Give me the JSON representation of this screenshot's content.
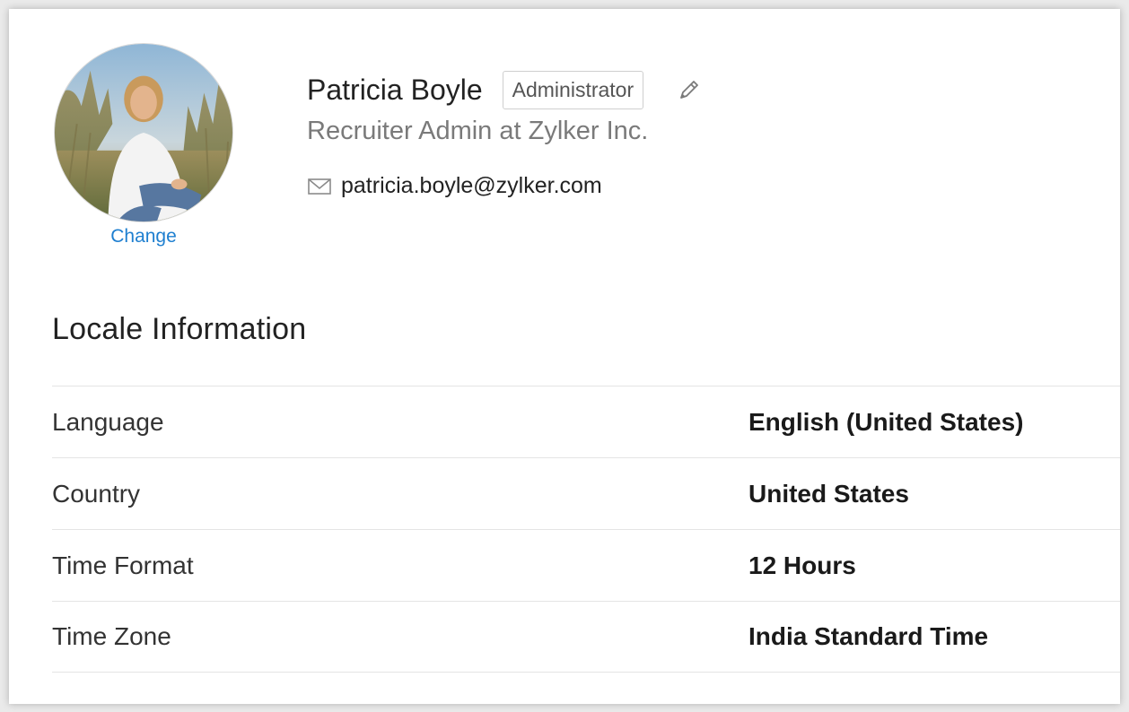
{
  "profile": {
    "name": "Patricia Boyle",
    "role_badge": "Administrator",
    "job_title": "Recruiter Admin at Zylker Inc.",
    "email": "patricia.boyle@zylker.com",
    "change_photo_label": "Change"
  },
  "locale": {
    "title": "Locale Information",
    "rows": [
      {
        "label": "Language",
        "value": "English (United States)"
      },
      {
        "label": "Country",
        "value": "United States"
      },
      {
        "label": "Time Format",
        "value": "12 Hours"
      },
      {
        "label": "Time Zone",
        "value": "India Standard Time"
      }
    ]
  },
  "icons": {
    "edit": "pencil-icon",
    "email": "mail-icon"
  },
  "colors": {
    "link": "#1e7fd0",
    "text_primary": "#222222",
    "text_secondary": "#7a7a7a",
    "divider": "#e4e4e4"
  }
}
